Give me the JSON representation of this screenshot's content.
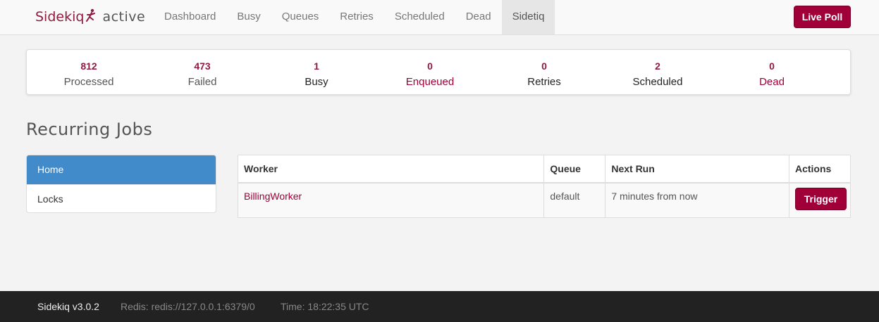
{
  "brand": {
    "name": "Sidekiq",
    "environment": "active",
    "icon": "sidekiq-logo-icon"
  },
  "nav": {
    "items": [
      {
        "label": "Dashboard",
        "active": false
      },
      {
        "label": "Busy",
        "active": false
      },
      {
        "label": "Queues",
        "active": false
      },
      {
        "label": "Retries",
        "active": false
      },
      {
        "label": "Scheduled",
        "active": false
      },
      {
        "label": "Dead",
        "active": false
      },
      {
        "label": "Sidetiq",
        "active": true
      }
    ],
    "live_poll_label": "Live Poll"
  },
  "summary": {
    "processed": {
      "count": "812",
      "label": "Processed"
    },
    "failed": {
      "count": "473",
      "label": "Failed"
    },
    "busy": {
      "count": "1",
      "label": "Busy"
    },
    "enqueued": {
      "count": "0",
      "label": "Enqueued"
    },
    "retries": {
      "count": "0",
      "label": "Retries"
    },
    "scheduled": {
      "count": "2",
      "label": "Scheduled"
    },
    "dead": {
      "count": "0",
      "label": "Dead"
    }
  },
  "page": {
    "title": "Recurring Jobs"
  },
  "sidebar": {
    "items": [
      {
        "label": "Home",
        "active": true
      },
      {
        "label": "Locks",
        "active": false
      }
    ]
  },
  "table": {
    "headers": {
      "worker": "Worker",
      "queue": "Queue",
      "next_run": "Next Run",
      "actions": "Actions"
    },
    "rows": [
      {
        "worker": "BillingWorker",
        "queue": "default",
        "next_run": "7 minutes from now",
        "action_label": "Trigger"
      }
    ]
  },
  "footer": {
    "version": "Sidekiq v3.0.2",
    "redis": "Redis: redis://127.0.0.1:6379/0",
    "time": "Time: 18:22:35 UTC"
  },
  "colors": {
    "accent": "#a00037",
    "active_nav": "#428bca",
    "footer_bg": "#222222"
  }
}
